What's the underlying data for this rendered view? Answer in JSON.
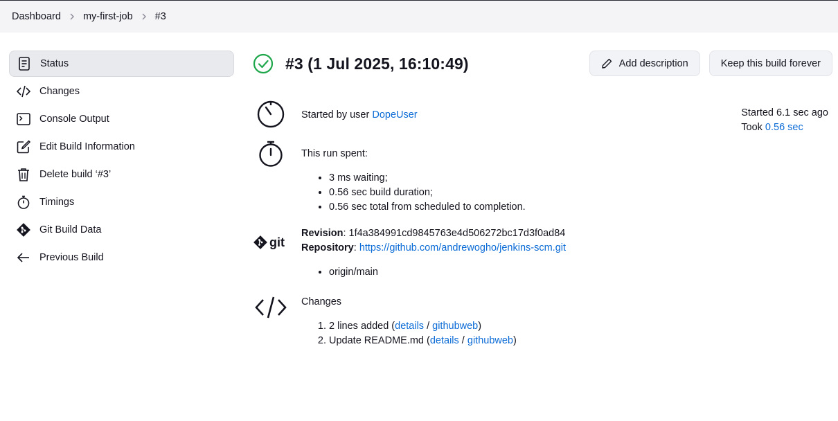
{
  "breadcrumb": [
    "Dashboard",
    "my-first-job",
    "#3"
  ],
  "sidebar": {
    "items": [
      {
        "label": "Status",
        "icon": "document-icon",
        "active": true
      },
      {
        "label": "Changes",
        "icon": "code-icon"
      },
      {
        "label": "Console Output",
        "icon": "terminal-icon"
      },
      {
        "label": "Edit Build Information",
        "icon": "edit-icon"
      },
      {
        "label": "Delete build ‘#3’",
        "icon": "trash-icon"
      },
      {
        "label": "Timings",
        "icon": "stopwatch-icon"
      },
      {
        "label": "Git Build Data",
        "icon": "git-icon"
      },
      {
        "label": "Previous Build",
        "icon": "arrow-left-icon"
      }
    ]
  },
  "header": {
    "title": "#3 (1 Jul 2025, 16:10:49)",
    "status": "success",
    "add_description": "Add description",
    "keep_forever": "Keep this build forever"
  },
  "started": {
    "prefix": "Started by user ",
    "user": "DopeUser",
    "started_ago": "Started 6.1 sec ago",
    "took_label": "Took ",
    "took_value": "0.56 sec"
  },
  "run_spent": {
    "label": "This run spent:",
    "items": [
      "3 ms waiting;",
      "0.56 sec build duration;",
      "0.56 sec total from scheduled to completion."
    ]
  },
  "git": {
    "logo_text": "git",
    "revision_label": "Revision",
    "revision": "1f4a384991cd9845763e4d506272bc17d3f0ad84",
    "repository_label": "Repository",
    "repository": "https://github.com/andrewogho/jenkins-scm.git",
    "branches": [
      "origin/main"
    ]
  },
  "changes": {
    "label": "Changes",
    "items": [
      {
        "text": "2 lines added",
        "details": "details",
        "web": "githubweb"
      },
      {
        "text": "Update README.md",
        "details": "details",
        "web": "githubweb"
      }
    ]
  },
  "colors": {
    "link": "#0b6bd6",
    "success": "#1ea64b"
  }
}
